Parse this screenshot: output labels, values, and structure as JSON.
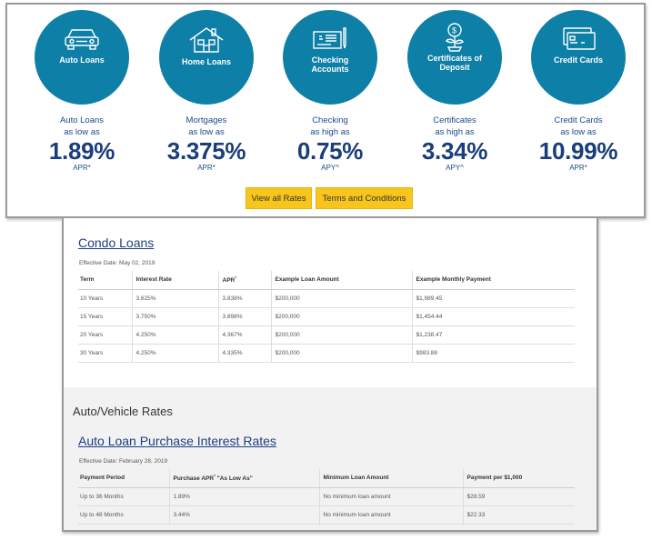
{
  "rates": [
    {
      "label": "Auto Loans",
      "desc1": "Auto Loans",
      "desc2": "as low as",
      "value": "1.89%",
      "unit": "APR*",
      "icon": "car-icon"
    },
    {
      "label": "Home Loans",
      "desc1": "Mortgages",
      "desc2": "as low as",
      "value": "3.375%",
      "unit": "APR*",
      "icon": "house-icon"
    },
    {
      "label": "Checking Accounts",
      "desc1": "Checking",
      "desc2": "as high as",
      "value": "0.75%",
      "unit": "APY^",
      "icon": "check-icon"
    },
    {
      "label": "Certificates of Deposit",
      "desc1": "Certificates",
      "desc2": "as high as",
      "value": "3.34%",
      "unit": "APY^",
      "icon": "plant-icon"
    },
    {
      "label": "Credit Cards",
      "desc1": "Credit Cards",
      "desc2": "as low as",
      "value": "10.99%",
      "unit": "APR*",
      "icon": "credit-card-icon"
    }
  ],
  "buttons": {
    "view_all": "View all Rates",
    "terms": "Terms and Conditions"
  },
  "condo": {
    "title": "Condo Loans",
    "effective": "Effective Date: May 02, 2019",
    "headers": [
      "Term",
      "Interest Rate",
      "APR",
      "Example Loan Amount",
      "Example Monthly Payment"
    ],
    "apr_sup": "*",
    "rows": [
      [
        "10 Years",
        "3.625%",
        "3.838%",
        "$200,000",
        "$1,989.45"
      ],
      [
        "15 Years",
        "3.750%",
        "3.898%",
        "$200,000",
        "$1,454.44"
      ],
      [
        "20 Years",
        "4.250%",
        "4.367%",
        "$200,000",
        "$1,238.47"
      ],
      [
        "30 Years",
        "4.250%",
        "4.335%",
        "$200,000",
        "$983.88"
      ]
    ]
  },
  "auto": {
    "section_title": "Auto/Vehicle Rates",
    "title": "Auto Loan Purchase Interest Rates",
    "effective": "Effective Date: February 28, 2019",
    "headers": [
      "Payment Period",
      "Purchase APR",
      "\"As Low As\"",
      "Minimum Loan Amount",
      "Payment per $1,000"
    ],
    "apr_sup": "*",
    "rows": [
      [
        "Up to 36 Months",
        "1.89%",
        "No minimum loan amount",
        "$28.59"
      ],
      [
        "Up to 48 Months",
        "3.44%",
        "No minimum loan amount",
        "$22.33"
      ]
    ]
  },
  "colors": {
    "circle": "#0e7fa6",
    "button": "#f7c51c",
    "rate_text": "#1a3d7c",
    "link": "#1f3f7f"
  }
}
